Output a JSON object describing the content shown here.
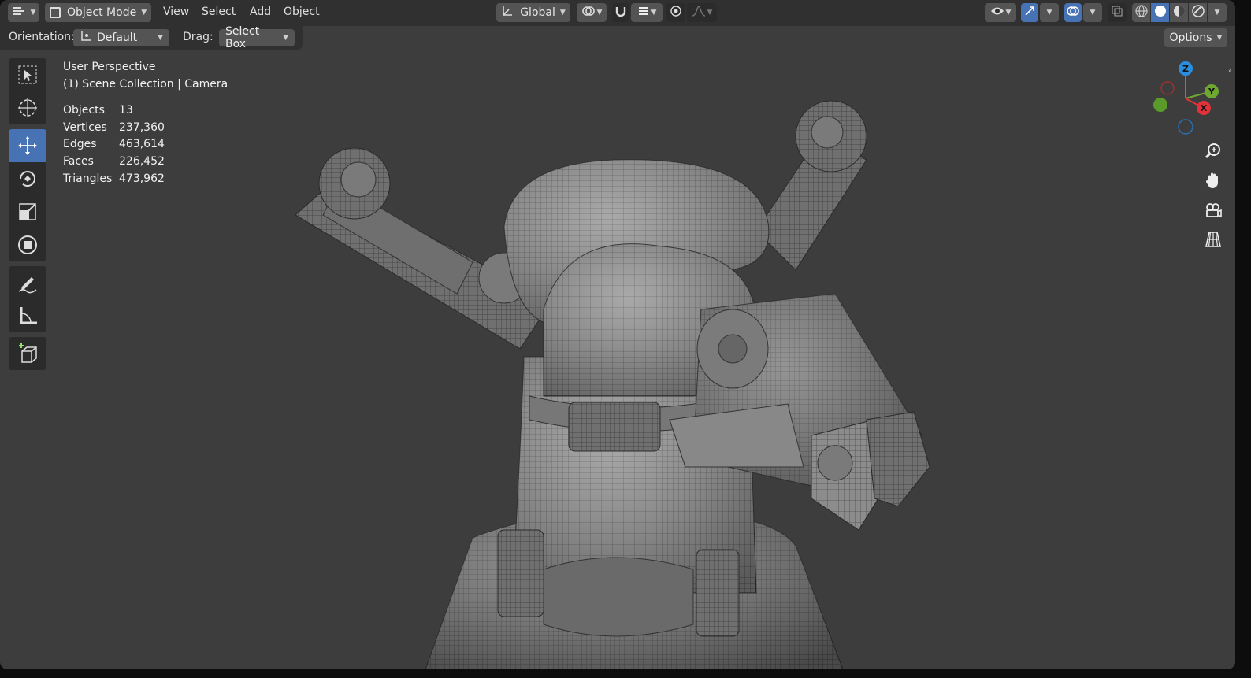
{
  "header": {
    "mode_label": "Object Mode",
    "menus": [
      "View",
      "Select",
      "Add",
      "Object"
    ],
    "transform_orientation": "Global"
  },
  "tool_settings": {
    "orientation_label": "Orientation:",
    "orientation_value": "Default",
    "drag_label": "Drag:",
    "drag_value": "Select Box",
    "options_label": "Options"
  },
  "viewport": {
    "view_name": "User Perspective",
    "scene_info": "(1) Scene Collection | Camera",
    "stats": [
      {
        "label": "Objects",
        "value": "13"
      },
      {
        "label": "Vertices",
        "value": "237,360"
      },
      {
        "label": "Edges",
        "value": "463,614"
      },
      {
        "label": "Faces",
        "value": "226,452"
      },
      {
        "label": "Triangles",
        "value": "473,962"
      }
    ]
  },
  "gizmo": {
    "axes": [
      "Z",
      "Y",
      "X"
    ],
    "colors": {
      "x": "#e0323a",
      "y": "#6ea830",
      "z": "#2a8ee0"
    }
  },
  "toolbar_tools": [
    "select-box",
    "cursor",
    "move",
    "rotate",
    "scale",
    "transform",
    "annotate",
    "measure",
    "add-cube"
  ],
  "nav_buttons": [
    "zoom",
    "pan",
    "camera-view",
    "perspective-toggle"
  ],
  "colors": {
    "accent": "#4772b3",
    "viewport_bg": "#3d3d3d",
    "header_bg": "#303030"
  }
}
